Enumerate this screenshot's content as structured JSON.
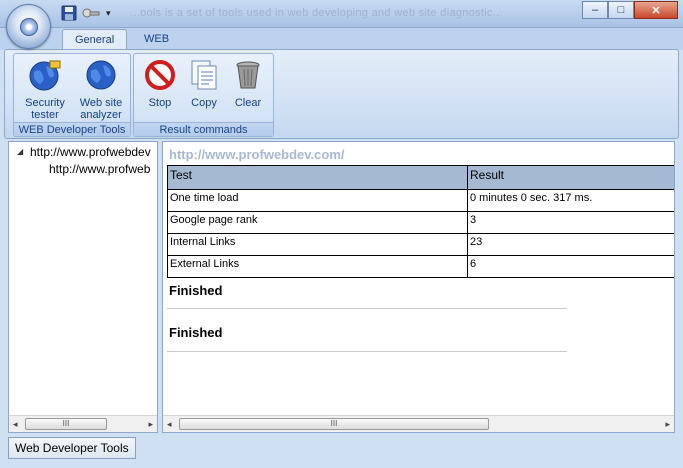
{
  "window": {
    "ghost_title": "...ools is a set of tools used in web developing and web site diagnostic..."
  },
  "quick_access": {
    "save_icon": "floppy-disk-icon",
    "tool_icon": "key-tool-icon"
  },
  "window_buttons": {
    "minimize": "–",
    "maximize": "□",
    "close": "✕"
  },
  "tabs": [
    {
      "label": "General",
      "active": true
    },
    {
      "label": "WEB",
      "active": false
    }
  ],
  "ribbon": {
    "groups": [
      {
        "label": "WEB Developer Tools",
        "buttons": [
          {
            "label_line1": "Security",
            "label_line2": "tester",
            "icon": "globe-lock-icon"
          },
          {
            "label_line1": "Web site",
            "label_line2": "analyzer",
            "icon": "globe-icon"
          }
        ]
      },
      {
        "label": "Result commands",
        "buttons": [
          {
            "label_line1": "Stop",
            "icon": "stop-icon"
          },
          {
            "label_line1": "Copy",
            "icon": "copy-icon"
          },
          {
            "label_line1": "Clear",
            "icon": "trash-icon"
          }
        ]
      }
    ]
  },
  "tree": {
    "expander": "◢",
    "nodes": [
      {
        "text": "http://www.profwebdev"
      },
      {
        "text": "http://www.profweb"
      }
    ]
  },
  "content": {
    "url": "http://www.profwebdev.com/",
    "table": {
      "headers": [
        "Test",
        "Result"
      ],
      "rows": [
        [
          "One time load",
          "0 minutes 0 sec. 317 ms."
        ],
        [
          "Google page rank",
          "3"
        ],
        [
          "Internal Links",
          "23"
        ],
        [
          "External Links",
          "6"
        ]
      ]
    },
    "finished": [
      "Finished",
      "Finished"
    ]
  },
  "scroll": {
    "left_arrow": "◂",
    "right_arrow": "▸",
    "grip": "III"
  },
  "status": {
    "label": "Web Developer Tools"
  },
  "colors": {
    "accent": "#15428b",
    "ribbon": "#d3e2f5",
    "header": "#a5b9d2",
    "url": "#a7b8d2"
  }
}
